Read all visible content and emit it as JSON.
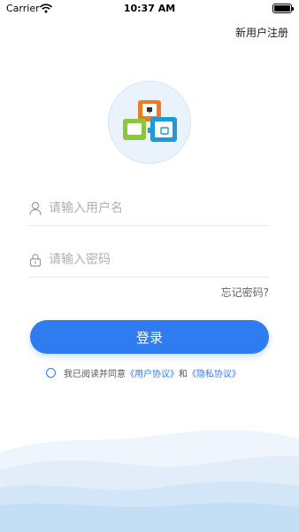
{
  "status_bar": {
    "carrier": "Carrier",
    "time": "10:37 AM",
    "battery_level": 1.0
  },
  "header": {
    "register_label": "新用户注册"
  },
  "form": {
    "username_placeholder": "请输入用户名",
    "password_placeholder": "请输入密码",
    "forgot_label": "忘记密码?",
    "login_label": "登录"
  },
  "agreement": {
    "prefix": "我已阅读并同意",
    "user_agreement": "《用户协议》",
    "conjunction": "和",
    "privacy_policy": "《隐私协议》"
  },
  "colors": {
    "primary": "#2f7cf0",
    "logo_orange": "#f07a22",
    "logo_green": "#8cc63f",
    "logo_blue": "#1e9ad6"
  }
}
